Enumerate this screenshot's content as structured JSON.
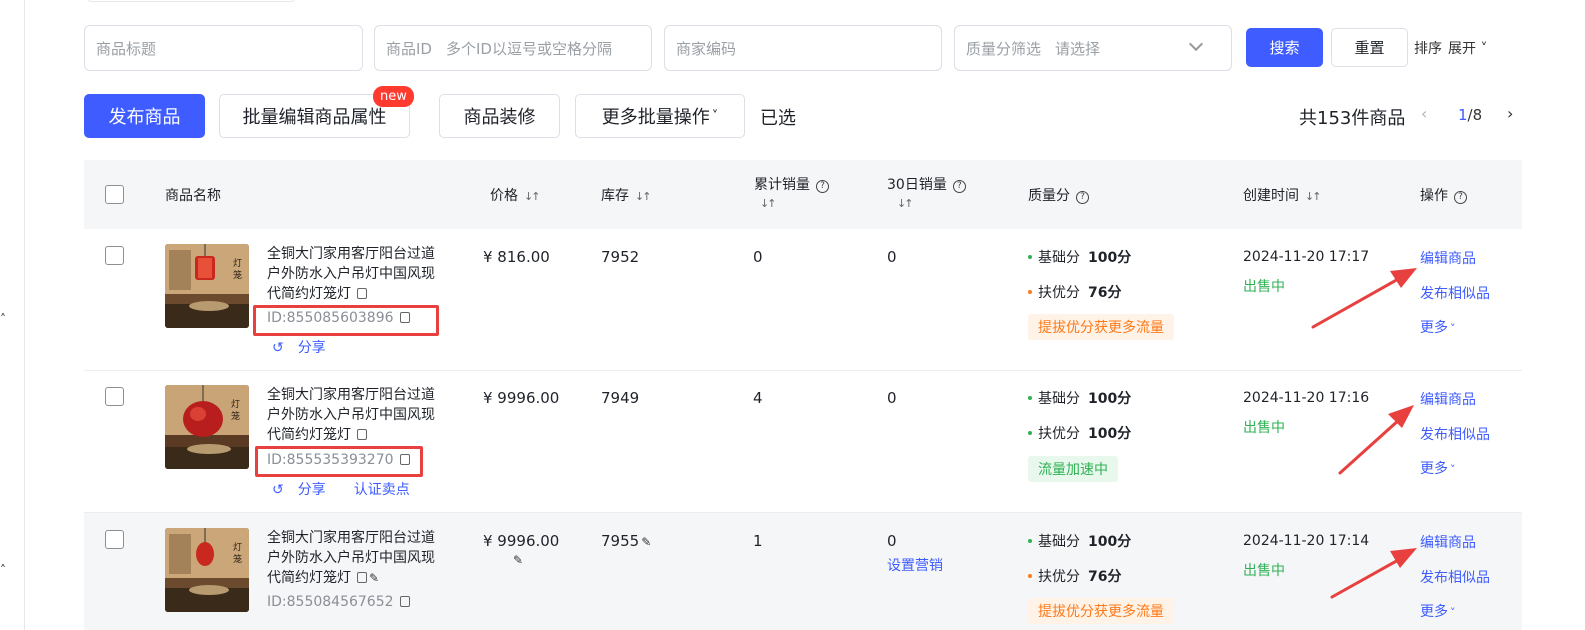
{
  "filters": {
    "title_placeholder": "商品标题",
    "id_label": "商品ID",
    "id_placeholder": "多个ID以逗号或空格分隔",
    "merchant_code_placeholder": "商家编码",
    "quality_label": "质量分筛选",
    "quality_placeholder": "请选择",
    "search_label": "搜索",
    "reset_label": "重置",
    "sort_label": "排序",
    "expand_label": "展开"
  },
  "actions": {
    "publish": "发布商品",
    "batch_edit": "批量编辑商品属性",
    "new_badge": "new",
    "decorate": "商品装修",
    "more_batch": "更多批量操作",
    "selected": "已选",
    "total": "共153件商品",
    "page_current": "1",
    "page_total": "/8"
  },
  "table": {
    "headers": {
      "name": "商品名称",
      "price": "价格",
      "stock": "库存",
      "cum_sales": "累计销量",
      "sales30": "30日销量",
      "quality": "质量分",
      "created": "创建时间",
      "ops": "操作"
    },
    "rows": [
      {
        "name": "全铜大门家用客厅阳台过道户外防水入户吊灯中国风现代简约灯笼灯",
        "id": "ID:855085603896",
        "links": [
          "分享"
        ],
        "price": "¥ 816.00",
        "stock": "7952",
        "cum_sales": "0",
        "sales30": "0",
        "base_label": "基础分",
        "base_score": "100分",
        "boost_label": "扶优分",
        "boost_score": "76分",
        "tag": "提拔优分获更多流量",
        "created": "2024-11-20 17:17",
        "status": "出售中",
        "op_edit": "编辑商品",
        "op_similar": "发布相似品",
        "op_more": "更多"
      },
      {
        "name": "全铜大门家用客厅阳台过道户外防水入户吊灯中国风现代简约灯笼灯",
        "id": "ID:855535393270",
        "links": [
          "分享",
          "认证卖点"
        ],
        "price": "¥ 9996.00",
        "stock": "7949",
        "cum_sales": "4",
        "sales30": "0",
        "base_label": "基础分",
        "base_score": "100分",
        "boost_label": "扶优分",
        "boost_score": "100分",
        "tag": "流量加速中",
        "created": "2024-11-20 17:16",
        "status": "出售中",
        "op_edit": "编辑商品",
        "op_similar": "发布相似品",
        "op_more": "更多"
      },
      {
        "name": "全铜大门家用客厅阳台过道户外防水入户吊灯中国风现代简约灯笼灯",
        "id": "ID:855084567652",
        "links": [],
        "price": "¥ 9996.00",
        "stock": "7955",
        "cum_sales": "1",
        "sales30": "0",
        "set_marketing": "设置营销",
        "base_label": "基础分",
        "base_score": "100分",
        "boost_label": "扶优分",
        "boost_score": "76分",
        "tag": "提拔优分获更多流量",
        "created": "2024-11-20 17:14",
        "status": "出售中",
        "op_edit": "编辑商品",
        "op_similar": "发布相似品",
        "op_more": "更多"
      }
    ]
  },
  "colors": {
    "primary": "#3e5cff",
    "annotation_red": "#e8403f",
    "green": "#2fb254",
    "orange": "#ff7a1a"
  }
}
